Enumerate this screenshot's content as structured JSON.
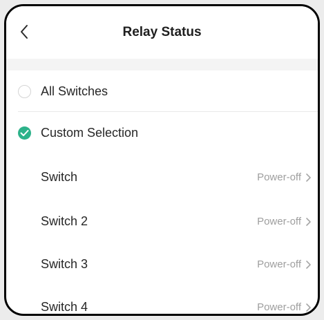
{
  "header": {
    "title": "Relay Status",
    "back_icon": "chevron-left-icon"
  },
  "options": [
    {
      "label": "All Switches",
      "selected": false
    },
    {
      "label": "Custom Selection",
      "selected": true
    }
  ],
  "switches": [
    {
      "label": "Switch",
      "value": "Power-off"
    },
    {
      "label": "Switch 2",
      "value": "Power-off"
    },
    {
      "label": "Switch 3",
      "value": "Power-off"
    },
    {
      "label": "Switch 4",
      "value": "Power-off"
    }
  ],
  "colors": {
    "accent": "#2db28a",
    "frame_border": "#000000",
    "muted_text": "#9e9e9e"
  }
}
